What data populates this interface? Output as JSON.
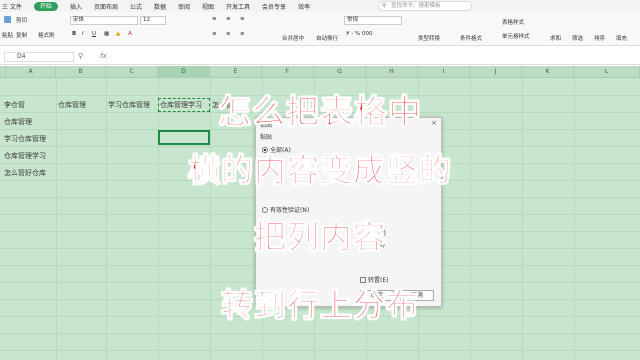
{
  "menubar": {
    "file_label": "三 文件",
    "items": [
      "开始",
      "插入",
      "页面布局",
      "公式",
      "数据",
      "审阅",
      "视图",
      "开发工具",
      "会员专享",
      "效率"
    ],
    "active_index": 0,
    "search_placeholder": "查找命令、搜索模板"
  },
  "ribbon": {
    "cut": "剪切",
    "paste": "粘贴",
    "copy": "复制",
    "format_painter": "格式刷",
    "font_name": "宋体",
    "font_size": "12",
    "number_format": "常规",
    "merge": "合并居中",
    "wrap": "自动换行",
    "type_convert": "类型转换",
    "cond_format": "条件格式",
    "table_style": "表格样式",
    "cell_style": "单元格样式",
    "sum": "求和",
    "filter": "筛选",
    "sort": "排序",
    "fill": "填充"
  },
  "formula_bar": {
    "cell_ref": "D4",
    "fx": "fx"
  },
  "sheet": {
    "columns": [
      "A",
      "B",
      "C",
      "D",
      "E",
      "F",
      "G",
      "H",
      "I",
      "J",
      "K",
      "L"
    ],
    "selected_column": "D",
    "cells": {
      "A2": "李仓管",
      "B2": "仓库管理",
      "C2": "学习仓库管理",
      "D2": "仓库管理学习",
      "E2": "怎么管",
      "A3": "仓库管理",
      "A4": "学习仓库管理",
      "A5": "仓库管理学习",
      "A6": "怎么管好仓库"
    }
  },
  "dialog": {
    "title": "粘贴",
    "section": "粘贴",
    "option_all": "全部(A)",
    "option_validation": "有效性验证(N)",
    "option_m": "(M)",
    "option_r": "(R)",
    "transpose": "转置(E)",
    "ok": "确定",
    "cancel": "取消"
  },
  "caption": {
    "line1": "怎么把表格中",
    "line2": "横的内容变成竖的",
    "line3": "把列内容",
    "line4": "转到行上分布"
  },
  "colors": {
    "accent": "#2e9f5b",
    "grid_bg": "#c8e6cd",
    "caption": "#e8141b"
  }
}
